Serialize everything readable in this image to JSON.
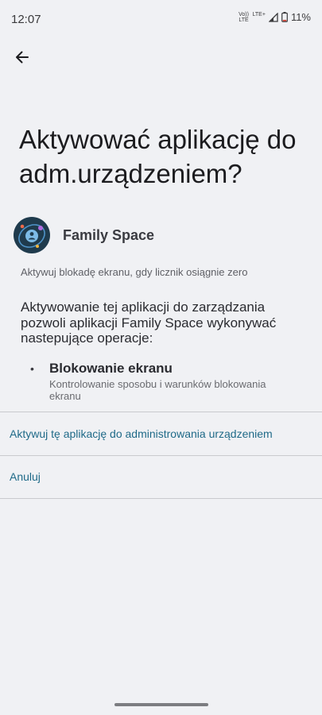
{
  "status_bar": {
    "time": "12:07",
    "volte": "Vo)) LTE",
    "network": "LTE+",
    "battery_percent": "11%"
  },
  "header": {
    "back_icon": "arrow-left-icon"
  },
  "title": "Aktywować aplikację do adm.urządzeniem?",
  "app": {
    "name": "Family Space",
    "icon": "family-space-app-icon",
    "description": "Aktywuj blokadę ekranu, gdy licznik osiągnie zero"
  },
  "explanation": "Aktywowanie tej aplikacji do zarządzania pozwoli aplikacji Family Space wykonywać nastepujące operacje:",
  "policies": [
    {
      "bullet": "•",
      "title": "Blokowanie ekranu",
      "description": "Kontrolowanie sposobu i warunków blokowania ekranu"
    }
  ],
  "actions": {
    "activate_label": "Aktywuj tę aplikację do administrowania urządzeniem",
    "cancel_label": "Anuluj"
  },
  "colors": {
    "background": "#f0f1f4",
    "accent_link": "#1f6a88",
    "app_icon_bg": "#1f3b4d"
  }
}
